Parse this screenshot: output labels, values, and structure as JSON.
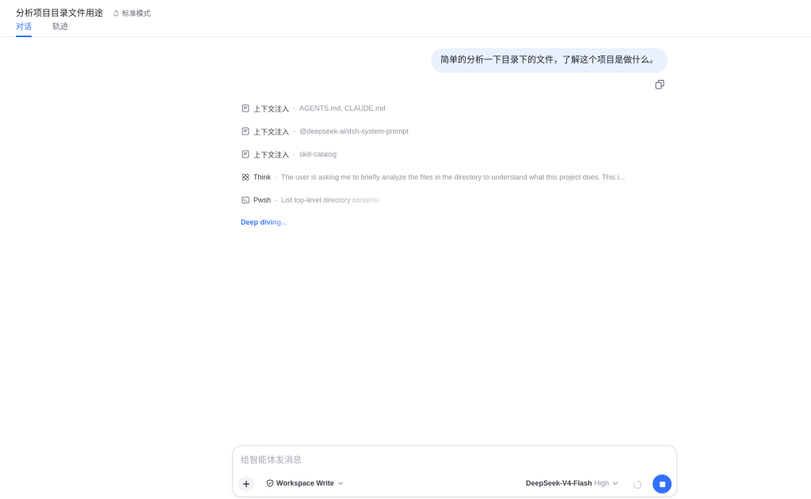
{
  "header": {
    "title": "分析项目目录文件用途",
    "mode_label": "标准模式",
    "tabs": [
      {
        "label": "对话",
        "active": true
      },
      {
        "label": "轨迹",
        "active": false
      }
    ]
  },
  "conversation": {
    "user_message": "简单的分析一下目录下的文件，了解这个项目是做什么。",
    "steps": [
      {
        "icon": "document-icon",
        "label": "上下文注入",
        "detail": "AGENTS.md, CLAUDE.md"
      },
      {
        "icon": "document-icon",
        "label": "上下文注入",
        "detail": "@deepseek-ai/dsh-system-prompt"
      },
      {
        "icon": "document-icon",
        "label": "上下文注入",
        "detail": "skill-catalog"
      },
      {
        "icon": "think-icon",
        "label": "Think",
        "detail": "The user is asking me to briefly analyze the files in the directory to understand what this project does. This i..."
      },
      {
        "icon": "terminal-icon",
        "label": "Pwsh",
        "detail": "List top-level directory contents"
      }
    ],
    "status": "Deep diving..."
  },
  "composer": {
    "placeholder": "给智能体发消息",
    "value": "",
    "workspace_label": "Workspace Write",
    "model_name": "DeepSeek-V4-Flash",
    "model_level": "High"
  },
  "colors": {
    "accent": "#3370ff",
    "user_bubble": "#e9f0fe",
    "muted_text": "#8f959e"
  }
}
